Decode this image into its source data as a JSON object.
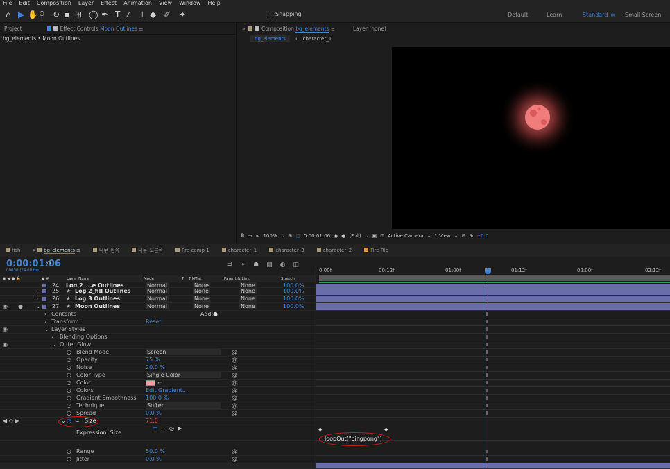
{
  "menu": [
    "File",
    "Edit",
    "Composition",
    "Layer",
    "Effect",
    "Animation",
    "View",
    "Window",
    "Help"
  ],
  "toolbar": {
    "snapping_label": "Snapping",
    "workspaces": [
      {
        "label": "Default",
        "active": false
      },
      {
        "label": "Learn",
        "active": false
      },
      {
        "label": "Standard",
        "active": true
      },
      {
        "label": "Small Screen",
        "active": false
      }
    ]
  },
  "left_panel": {
    "tab_project": "Project",
    "tab_effect_controls_prefix": "Effect Controls",
    "tab_effect_controls_layer": "Moon Outlines",
    "breadcrumb": "bg_elements • Moon Outlines"
  },
  "comp_panel": {
    "tab_prefix": "Composition",
    "tab_comp": "bg_elements",
    "layer_tab": "Layer (none)",
    "crumbs": [
      "bg_elements",
      "character_1"
    ]
  },
  "viewer_bar": {
    "zoom": "100%",
    "timecode": "0:00:01:06",
    "resolution": "(Full)",
    "camera": "Active Camera",
    "views": "1 View",
    "exposure": "+0.0"
  },
  "timeline_tabs": [
    {
      "label": "fish",
      "color": "#a89a7a"
    },
    {
      "label": "bg_elements",
      "color": "#a89a7a",
      "active": true
    },
    {
      "label": "나무_왼쪽",
      "color": "#a89a7a"
    },
    {
      "label": "나무_오른쪽",
      "color": "#a89a7a"
    },
    {
      "label": "Pre-comp 1",
      "color": "#a89a7a"
    },
    {
      "label": "character_1",
      "color": "#a89a7a"
    },
    {
      "label": "character_3",
      "color": "#a89a7a"
    },
    {
      "label": "character_2",
      "color": "#a89a7a"
    },
    {
      "label": "Fire Rig",
      "color": "#e39a2a"
    }
  ],
  "timeline": {
    "timecode": "0:00:01:06",
    "subcode": "00030 (24.00 fps)"
  },
  "columns": {
    "layer_name": "Layer Name",
    "mode": "Mode",
    "t": "T",
    "trkmat": "TrkMat",
    "parent": "Parent & Link",
    "stretch": "Stretch"
  },
  "layers": [
    {
      "num": "24",
      "name": "Log 2_...e Outlines",
      "mode": "Normal",
      "trk": "None",
      "parent": "None",
      "stretch": "100.0%"
    },
    {
      "num": "25",
      "name": "Log 2_fill Outlines",
      "mode": "Normal",
      "trk": "None",
      "parent": "None",
      "stretch": "100.0%"
    },
    {
      "num": "26",
      "name": "Log 3 Outlines",
      "mode": "Normal",
      "trk": "None",
      "parent": "None",
      "stretch": "100.0%"
    },
    {
      "num": "27",
      "name": "Moon Outlines",
      "mode": "Normal",
      "trk": "None",
      "parent": "None",
      "stretch": "100.0%"
    }
  ],
  "props": {
    "contents": "Contents",
    "add_label": "Add:",
    "transform": "Transform",
    "reset": "Reset",
    "layer_styles": "Layer Styles",
    "blending_options": "Blending Options",
    "outer_glow": "Outer Glow",
    "items": [
      {
        "label": "Blend Mode",
        "value": "Screen",
        "kind": "dropdown"
      },
      {
        "label": "Opacity",
        "value": "75 %",
        "kind": "val"
      },
      {
        "label": "Noise",
        "value": "20.0 %",
        "kind": "val"
      },
      {
        "label": "Color Type",
        "value": "Single Color",
        "kind": "dropdown"
      },
      {
        "label": "Color",
        "value": "",
        "kind": "swatch"
      },
      {
        "label": "Colors",
        "value": "Edit Gradient...",
        "kind": "val"
      },
      {
        "label": "Gradient Smoothness",
        "value": "100.0 %",
        "kind": "val"
      },
      {
        "label": "Technique",
        "value": "Softer",
        "kind": "dropdown"
      },
      {
        "label": "Spread",
        "value": "0.0 %",
        "kind": "val"
      }
    ],
    "size_label": "Size",
    "size_value": "71.0",
    "expression_label": "Expression: Size",
    "range_label": "Range",
    "range_value": "50.0 %",
    "jitter_label": "Jitter",
    "jitter_value": "0.0 %"
  },
  "ruler": [
    "0:00f",
    "00:12f",
    "01:00f",
    "01:12f",
    "02:00f",
    "02:12f"
  ],
  "expression_text": "loopOut(\"pingpong\")",
  "colors": {
    "accent": "#3f86d6",
    "layer_bar": "#6a6ea8",
    "moon": "#f07c7c",
    "annotation": "#d01c1c"
  }
}
